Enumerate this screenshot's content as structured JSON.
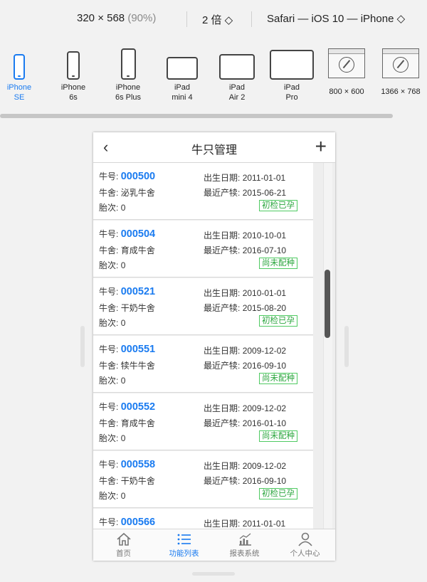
{
  "toolbar": {
    "resolution": "320 × 568",
    "zoom": "(90%)",
    "scale": "2 倍 ◇",
    "device_info": "Safari — iOS 10 — iPhone ◇"
  },
  "devices": [
    {
      "line1": "iPhone",
      "line2": "SE"
    },
    {
      "line1": "iPhone",
      "line2": "6s"
    },
    {
      "line1": "iPhone",
      "line2": "6s Plus"
    },
    {
      "line1": "iPad",
      "line2": "mini 4"
    },
    {
      "line1": "iPad",
      "line2": "Air 2"
    },
    {
      "line1": "iPad",
      "line2": "Pro"
    },
    {
      "line1": "800 × 600",
      "line2": ""
    },
    {
      "line1": "1366 × 768",
      "line2": ""
    }
  ],
  "app": {
    "title": "牛只管理",
    "back_icon": "‹",
    "add_icon": "+",
    "labels": {
      "cow_no": "牛号:",
      "barn": "牛舍:",
      "parity": "胎次:",
      "birth": "出生日期:",
      "calving": "最近产犊:"
    },
    "cows": [
      {
        "no": "000500",
        "barn": "泌乳牛舍",
        "parity": "0",
        "birth": "2011-01-01",
        "calving": "2015-06-21",
        "status": "初检已孕"
      },
      {
        "no": "000504",
        "barn": "育成牛舍",
        "parity": "0",
        "birth": "2010-10-01",
        "calving": "2016-07-10",
        "status": "尚未配种"
      },
      {
        "no": "000521",
        "barn": "干奶牛舍",
        "parity": "0",
        "birth": "2010-01-01",
        "calving": "2015-08-20",
        "status": "初检已孕"
      },
      {
        "no": "000551",
        "barn": "犊牛牛舍",
        "parity": "0",
        "birth": "2009-12-02",
        "calving": "2016-09-10",
        "status": "尚未配种"
      },
      {
        "no": "000552",
        "barn": "育成牛舍",
        "parity": "0",
        "birth": "2009-12-02",
        "calving": "2016-01-10",
        "status": "尚未配种"
      },
      {
        "no": "000558",
        "barn": "干奶牛舍",
        "parity": "0",
        "birth": "2009-12-02",
        "calving": "2016-09-10",
        "status": "初检已孕"
      },
      {
        "no": "000566",
        "barn": "",
        "parity": "",
        "birth": "2011-01-01",
        "calving": "",
        "status": ""
      }
    ],
    "tabs": [
      {
        "label": "首页",
        "icon": "home-icon"
      },
      {
        "label": "功能列表",
        "icon": "list-icon"
      },
      {
        "label": "报表系统",
        "icon": "chart-icon"
      },
      {
        "label": "个人中心",
        "icon": "user-icon"
      }
    ]
  },
  "colors": {
    "accent": "#1a7bf0",
    "tag_green": "#2ba63e"
  }
}
